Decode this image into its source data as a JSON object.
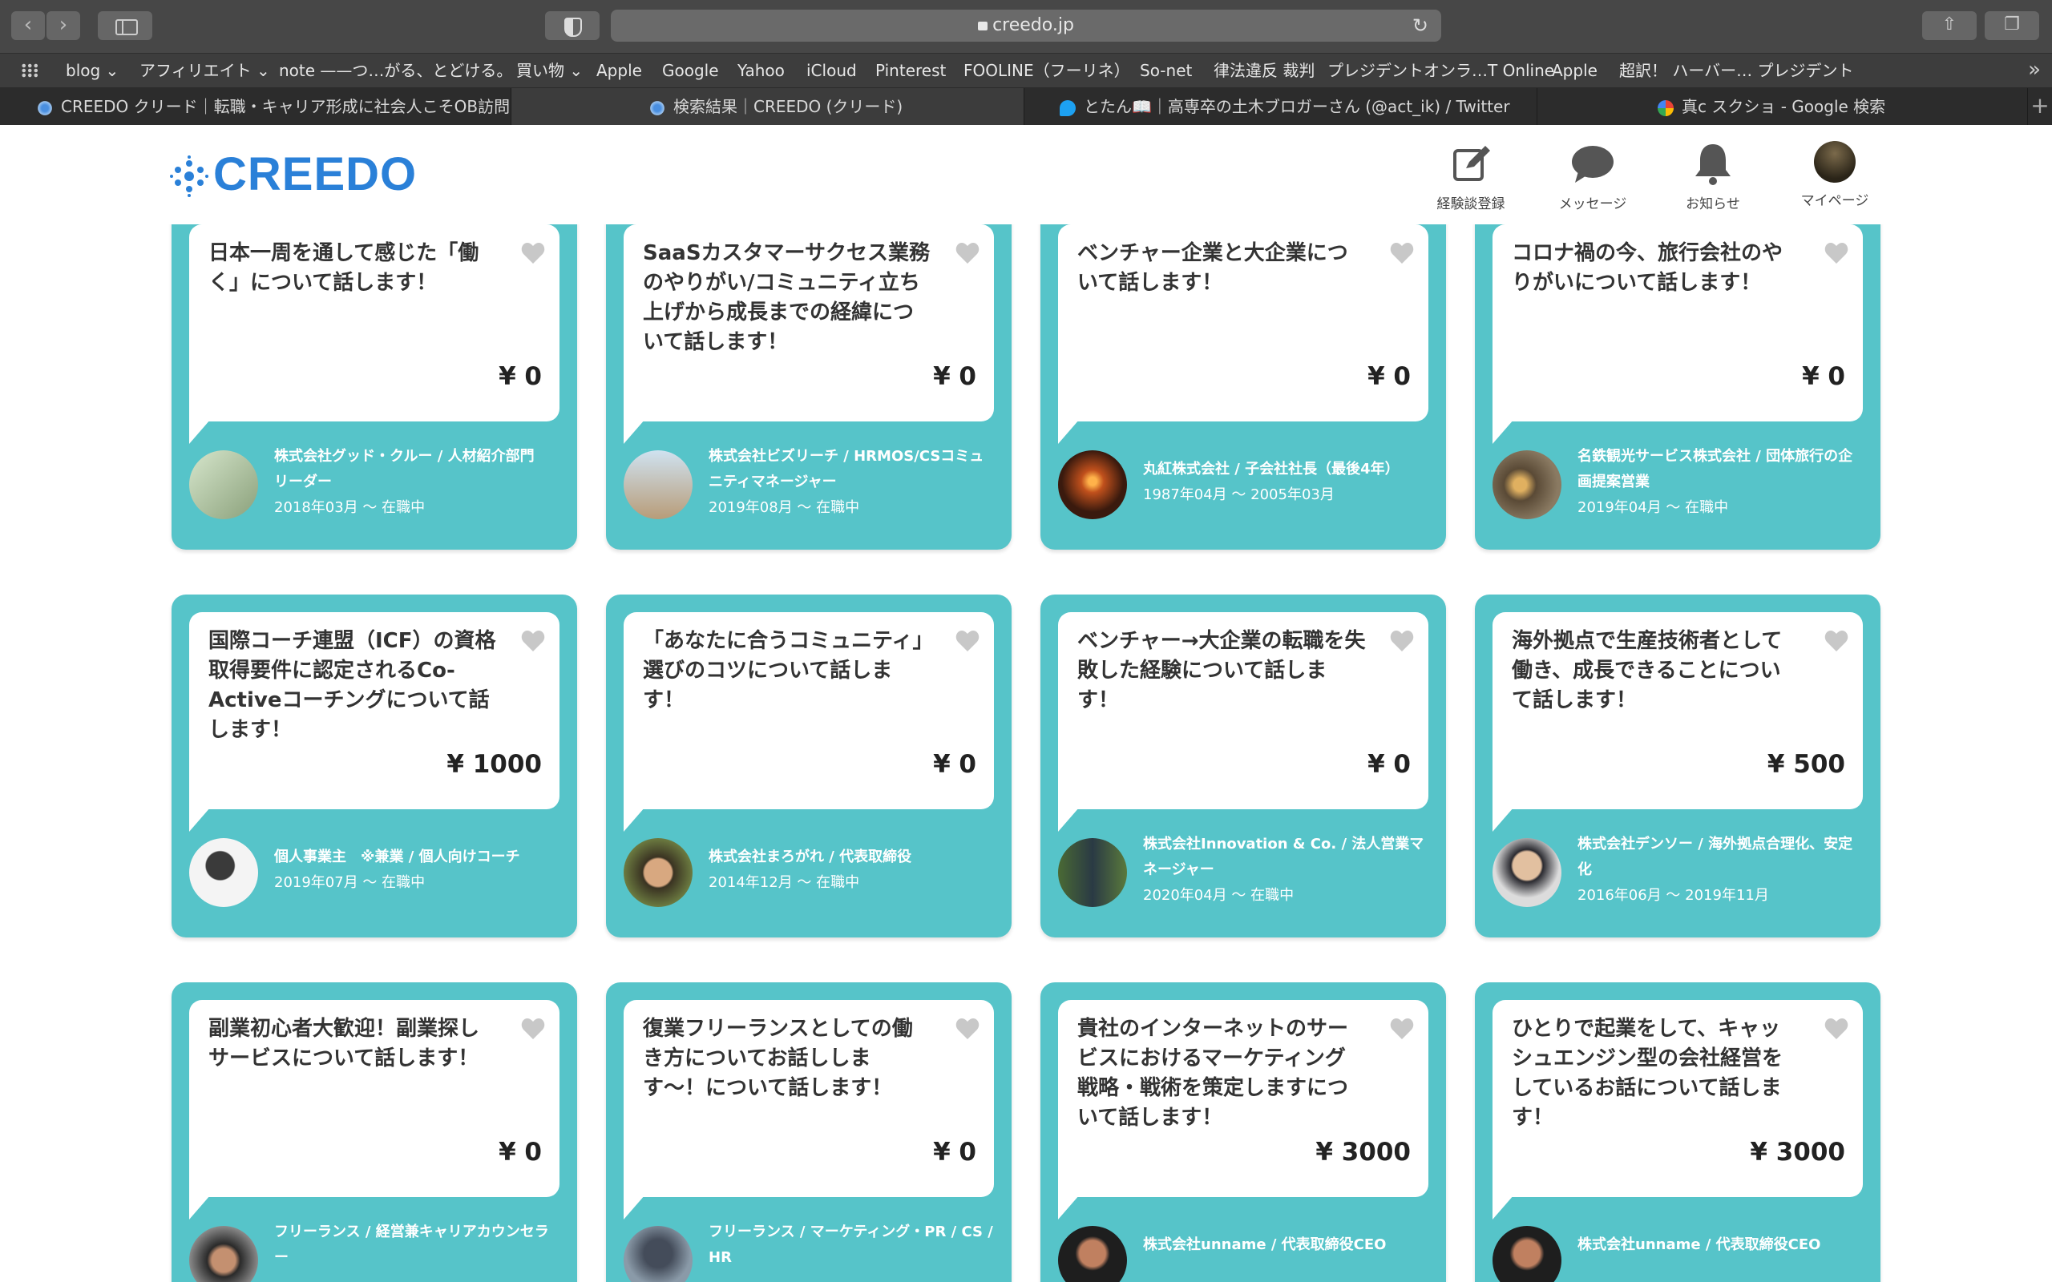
{
  "browser": {
    "url": "creedo.jp",
    "favorites": [
      "blog",
      "アフィリエイト",
      "note ——つ…がる、とどける。",
      "買い物",
      "Apple",
      "Google",
      "Yahoo",
      "iCloud",
      "Pinterest",
      "FOOLINE（フーリネ）",
      "So-net",
      "律法違反 裁判",
      "プレジデントオンラ…T Online",
      "Apple",
      "超訳！ ハーバー… プレジデント"
    ],
    "tabs": [
      {
        "label": "CREEDO クリード｜転職・キャリア形成に社会人こそOB訪問",
        "icon": "creedo-icon"
      },
      {
        "label": "検索結果｜CREEDO (クリード)",
        "icon": "creedo-icon"
      },
      {
        "label": "とたん📖｜高専卒の土木ブロガーさん (@act_ik) / Twitter",
        "icon": "twitter-icon"
      },
      {
        "label": "真c スクショ - Google 検索",
        "icon": "google-icon"
      }
    ]
  },
  "header": {
    "logo": "CREEDO",
    "nav": [
      {
        "label": "経験談登録",
        "icon": "edit-icon"
      },
      {
        "label": "メッセージ",
        "icon": "message-icon"
      },
      {
        "label": "お知らせ",
        "icon": "bell-icon"
      },
      {
        "label": "マイページ",
        "icon": "avatar"
      }
    ]
  },
  "cards": [
    {
      "title": "日本一周を通して感じた「働く」について話します！",
      "price": "¥ 0",
      "company": "株式会社グッド・クルー / 人材紹介部門　リーダー",
      "period": "2018年03月 〜 在職中"
    },
    {
      "title": "SaaSカスタマーサクセス業務のやりがい/コミュニティ立ち上げから成長までの経緯について話します！",
      "price": "¥ 0",
      "company": "株式会社ビズリーチ / HRMOS/CSコミュニティマネージャー",
      "period": "2019年08月 〜 在職中"
    },
    {
      "title": "ベンチャー企業と大企業について話します！",
      "price": "¥ 0",
      "company": "丸紅株式会社 / 子会社社長（最後4年）",
      "period": "1987年04月 〜 2005年03月"
    },
    {
      "title": "コロナ禍の今、旅行会社のやりがいについて話します！",
      "price": "¥ 0",
      "company": "名鉄観光サービス株式会社 / 団体旅行の企画提案営業",
      "period": "2019年04月 〜 在職中"
    },
    {
      "title": "国際コーチ連盟（ICF）の資格取得要件に認定されるCo-Activeコーチングについて話します！",
      "price": "¥ 1000",
      "company": "個人事業主　※兼業 / 個人向けコーチ",
      "period": "2019年07月 〜 在職中"
    },
    {
      "title": "「あなたに合うコミュニティ」選びのコツについて話します！",
      "price": "¥ 0",
      "company": "株式会社まろがれ / 代表取締役",
      "period": "2014年12月 〜 在職中"
    },
    {
      "title": "ベンチャー→大企業の転職を失敗した経験について話します！",
      "price": "¥ 0",
      "company": "株式会社Innovation & Co. / 法人営業マネージャー",
      "period": "2020年04月 〜 在職中"
    },
    {
      "title": "海外拠点で生産技術者として働き、成長できることについて話します！",
      "price": "¥ 500",
      "company": "株式会社デンソー / 海外拠点合理化、安定化",
      "period": "2016年06月 〜 2019年11月"
    },
    {
      "title": "副業初心者大歓迎！副業探しサービスについて話します！",
      "price": "¥ 0",
      "company": "フリーランス / 経営兼キャリアカウンセラー",
      "period": ""
    },
    {
      "title": "復業フリーランスとしての働き方についてお話しします〜！について話します！",
      "price": "¥ 0",
      "company": "フリーランス / マーケティング・PR / CS / HR",
      "period": ""
    },
    {
      "title": "貴社のインターネットのサービスにおけるマーケティング戦略・戦術を策定しますについて話します！",
      "price": "¥ 3000",
      "company": "株式会社unname / 代表取締役CEO",
      "period": ""
    },
    {
      "title": "ひとりで起業をして、キャッシュエンジン型の会社経営をしているお話について話します！",
      "price": "¥ 3000",
      "company": "株式会社unname / 代表取締役CEO",
      "period": ""
    }
  ]
}
